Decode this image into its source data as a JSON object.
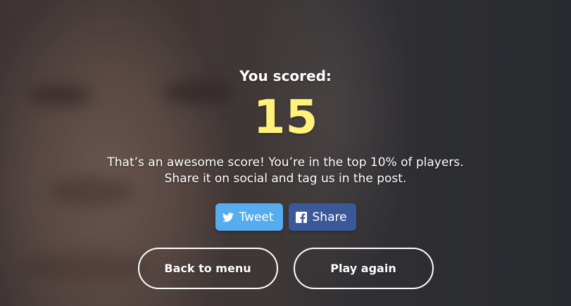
{
  "result": {
    "label": "You scored:",
    "score": "15",
    "message_line1": "That’s an awesome score! You’re in the top 10% of players.",
    "message_line2": "Share it on social and tag us in the post."
  },
  "social": {
    "tweet_label": "Tweet",
    "tweet_icon": "twitter-bird-icon",
    "share_label": "Share",
    "share_icon": "facebook-icon"
  },
  "actions": {
    "back_label": "Back to menu",
    "play_again_label": "Play again"
  },
  "colors": {
    "score": "#fff17a",
    "tweet": "#55acee",
    "share": "#3b5998",
    "outline": "#ffffff"
  }
}
